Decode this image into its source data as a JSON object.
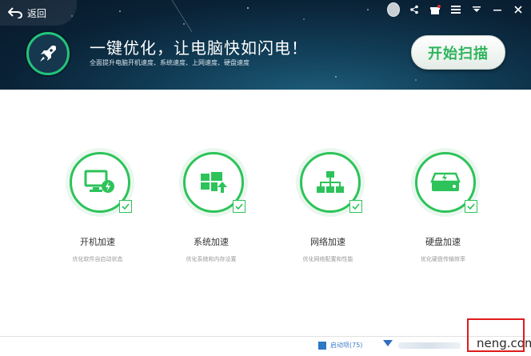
{
  "header": {
    "back_label": "返回",
    "headline": "一键优化，让电脑快如闪电！",
    "subline": "全面提升电脑开机速度、系统速度、上网速度、硬盘速度",
    "scan_button": "开始扫描"
  },
  "items": [
    {
      "title": "开机加速",
      "desc": "优化软件自启动状态",
      "icon": "monitor-bolt-icon"
    },
    {
      "title": "系统加速",
      "desc": "优化系统和内存设置",
      "icon": "windows-logo-icon"
    },
    {
      "title": "网络加速",
      "desc": "优化网络配置和性能",
      "icon": "network-icon"
    },
    {
      "title": "硬盘加速",
      "desc": "优化硬盘传输效率",
      "icon": "harddisk-bolt-icon"
    }
  ],
  "footer": {
    "startup_items": "启动项(75)",
    "watermark": "neng.com"
  },
  "colors": {
    "accent_green": "#2dc35a",
    "header_dark": "#0a2236",
    "highlight_red": "#e01b1b"
  }
}
